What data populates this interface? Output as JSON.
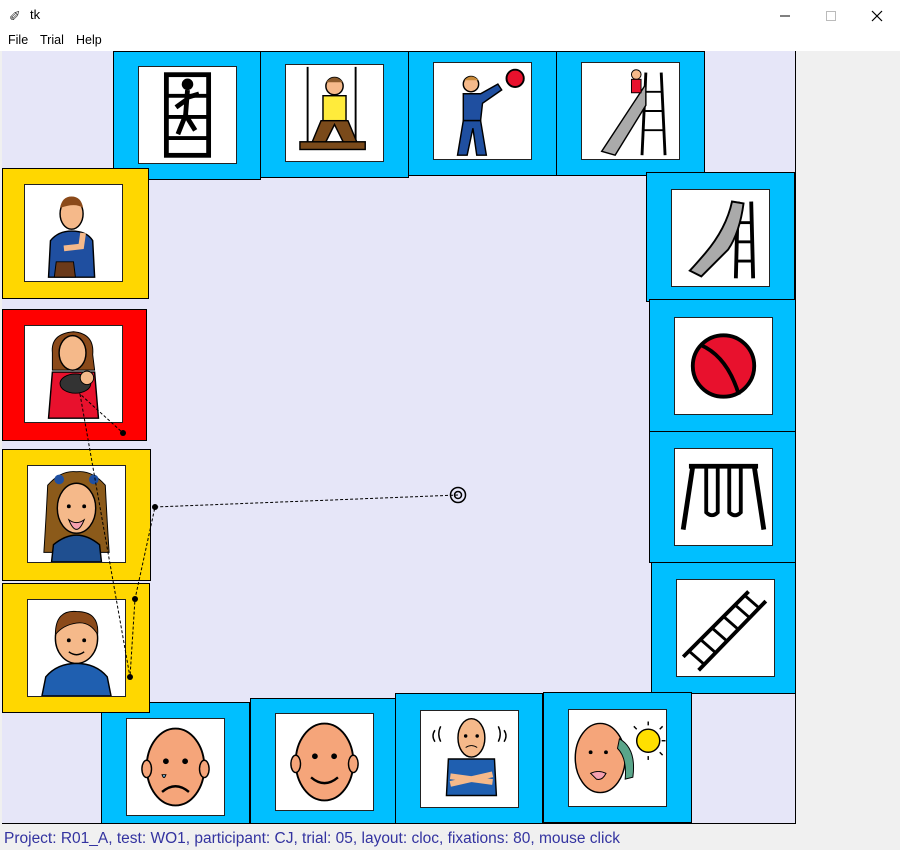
{
  "window": {
    "title": "tk"
  },
  "menu": {
    "items": [
      "File",
      "Trial",
      "Help"
    ]
  },
  "status_text": "Project: R01_A, test: WO1, participant: CJ, trial: 05, layout: cloc, fixations: 80, mouse click",
  "colors": {
    "canvas_bg": "#e6e6f8",
    "tile_blue": "#00bfff",
    "tile_yellow": "#ffd700",
    "tile_red": "#ff0000",
    "status_text": "#3333a0",
    "trace": "#000000"
  },
  "tiles": [
    {
      "id": "climb-wall",
      "color": "blue",
      "icon": "climbing-wall-icon"
    },
    {
      "id": "swing-kid",
      "color": "blue",
      "icon": "child-on-swing-icon"
    },
    {
      "id": "throw-ball",
      "color": "blue",
      "icon": "boy-throwing-ball-icon"
    },
    {
      "id": "slide-kid",
      "color": "blue",
      "icon": "child-on-slide-icon"
    },
    {
      "id": "slide",
      "color": "blue",
      "icon": "slide-icon"
    },
    {
      "id": "ball",
      "color": "blue",
      "icon": "ball-icon"
    },
    {
      "id": "swings",
      "color": "blue",
      "icon": "swing-set-icon"
    },
    {
      "id": "ladder",
      "color": "blue",
      "icon": "ladder-icon"
    },
    {
      "id": "hot",
      "color": "blue",
      "icon": "hot-sweating-face-icon"
    },
    {
      "id": "cold",
      "color": "blue",
      "icon": "cold-shivering-person-icon"
    },
    {
      "id": "happy",
      "color": "blue",
      "icon": "happy-face-icon"
    },
    {
      "id": "sad",
      "color": "blue",
      "icon": "sad-face-icon"
    },
    {
      "id": "man",
      "color": "yellow",
      "icon": "man-portrait-icon"
    },
    {
      "id": "girl",
      "color": "yellow",
      "icon": "girl-portrait-icon"
    },
    {
      "id": "mother-baby",
      "color": "red",
      "icon": "mother-holding-baby-icon"
    },
    {
      "id": "me",
      "color": "yellow",
      "icon": "person-pointing-self-icon"
    }
  ]
}
